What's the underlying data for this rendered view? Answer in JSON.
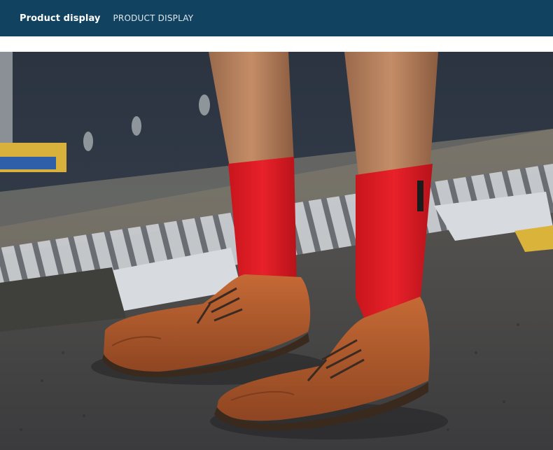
{
  "header": {
    "title": "Product display",
    "subtitle": "PRODUCT DISPLAY"
  },
  "photo": {
    "sock_color": "#e31b23",
    "shoe_color": "#b55a2b",
    "header_color": "#114361"
  }
}
